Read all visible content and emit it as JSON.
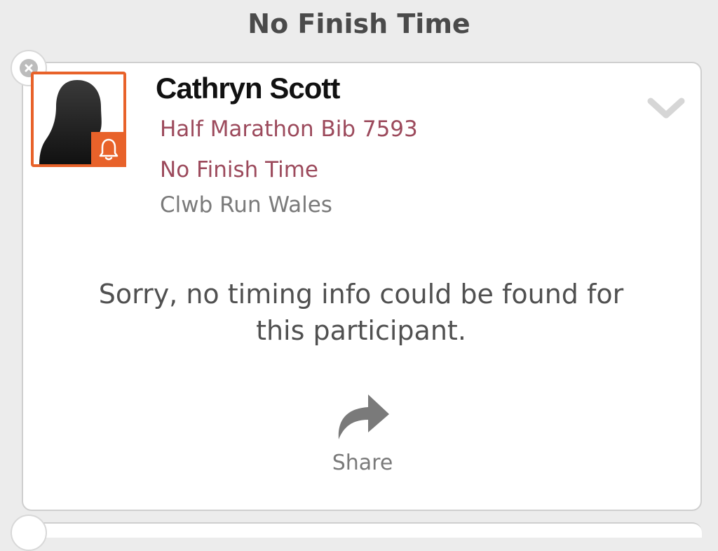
{
  "header": {
    "title": "No Finish Time"
  },
  "participant": {
    "name": "Cathryn Scott",
    "event": "Half Marathon Bib 7593",
    "status": "No Finish Time",
    "club": "Clwb Run Wales"
  },
  "message": {
    "line1": "Sorry, no timing info could be found for",
    "line2": "this participant."
  },
  "actions": {
    "share_label": "Share"
  },
  "icons": {
    "close": "close-icon",
    "avatar": "female-silhouette-icon",
    "bell": "bell-icon",
    "expand": "chevron-down-icon",
    "share": "share-arrow-icon"
  },
  "colors": {
    "accent": "#e8622a",
    "event_text": "#9c4a5c",
    "muted_text": "#7a7a7a",
    "background": "#ececec"
  }
}
